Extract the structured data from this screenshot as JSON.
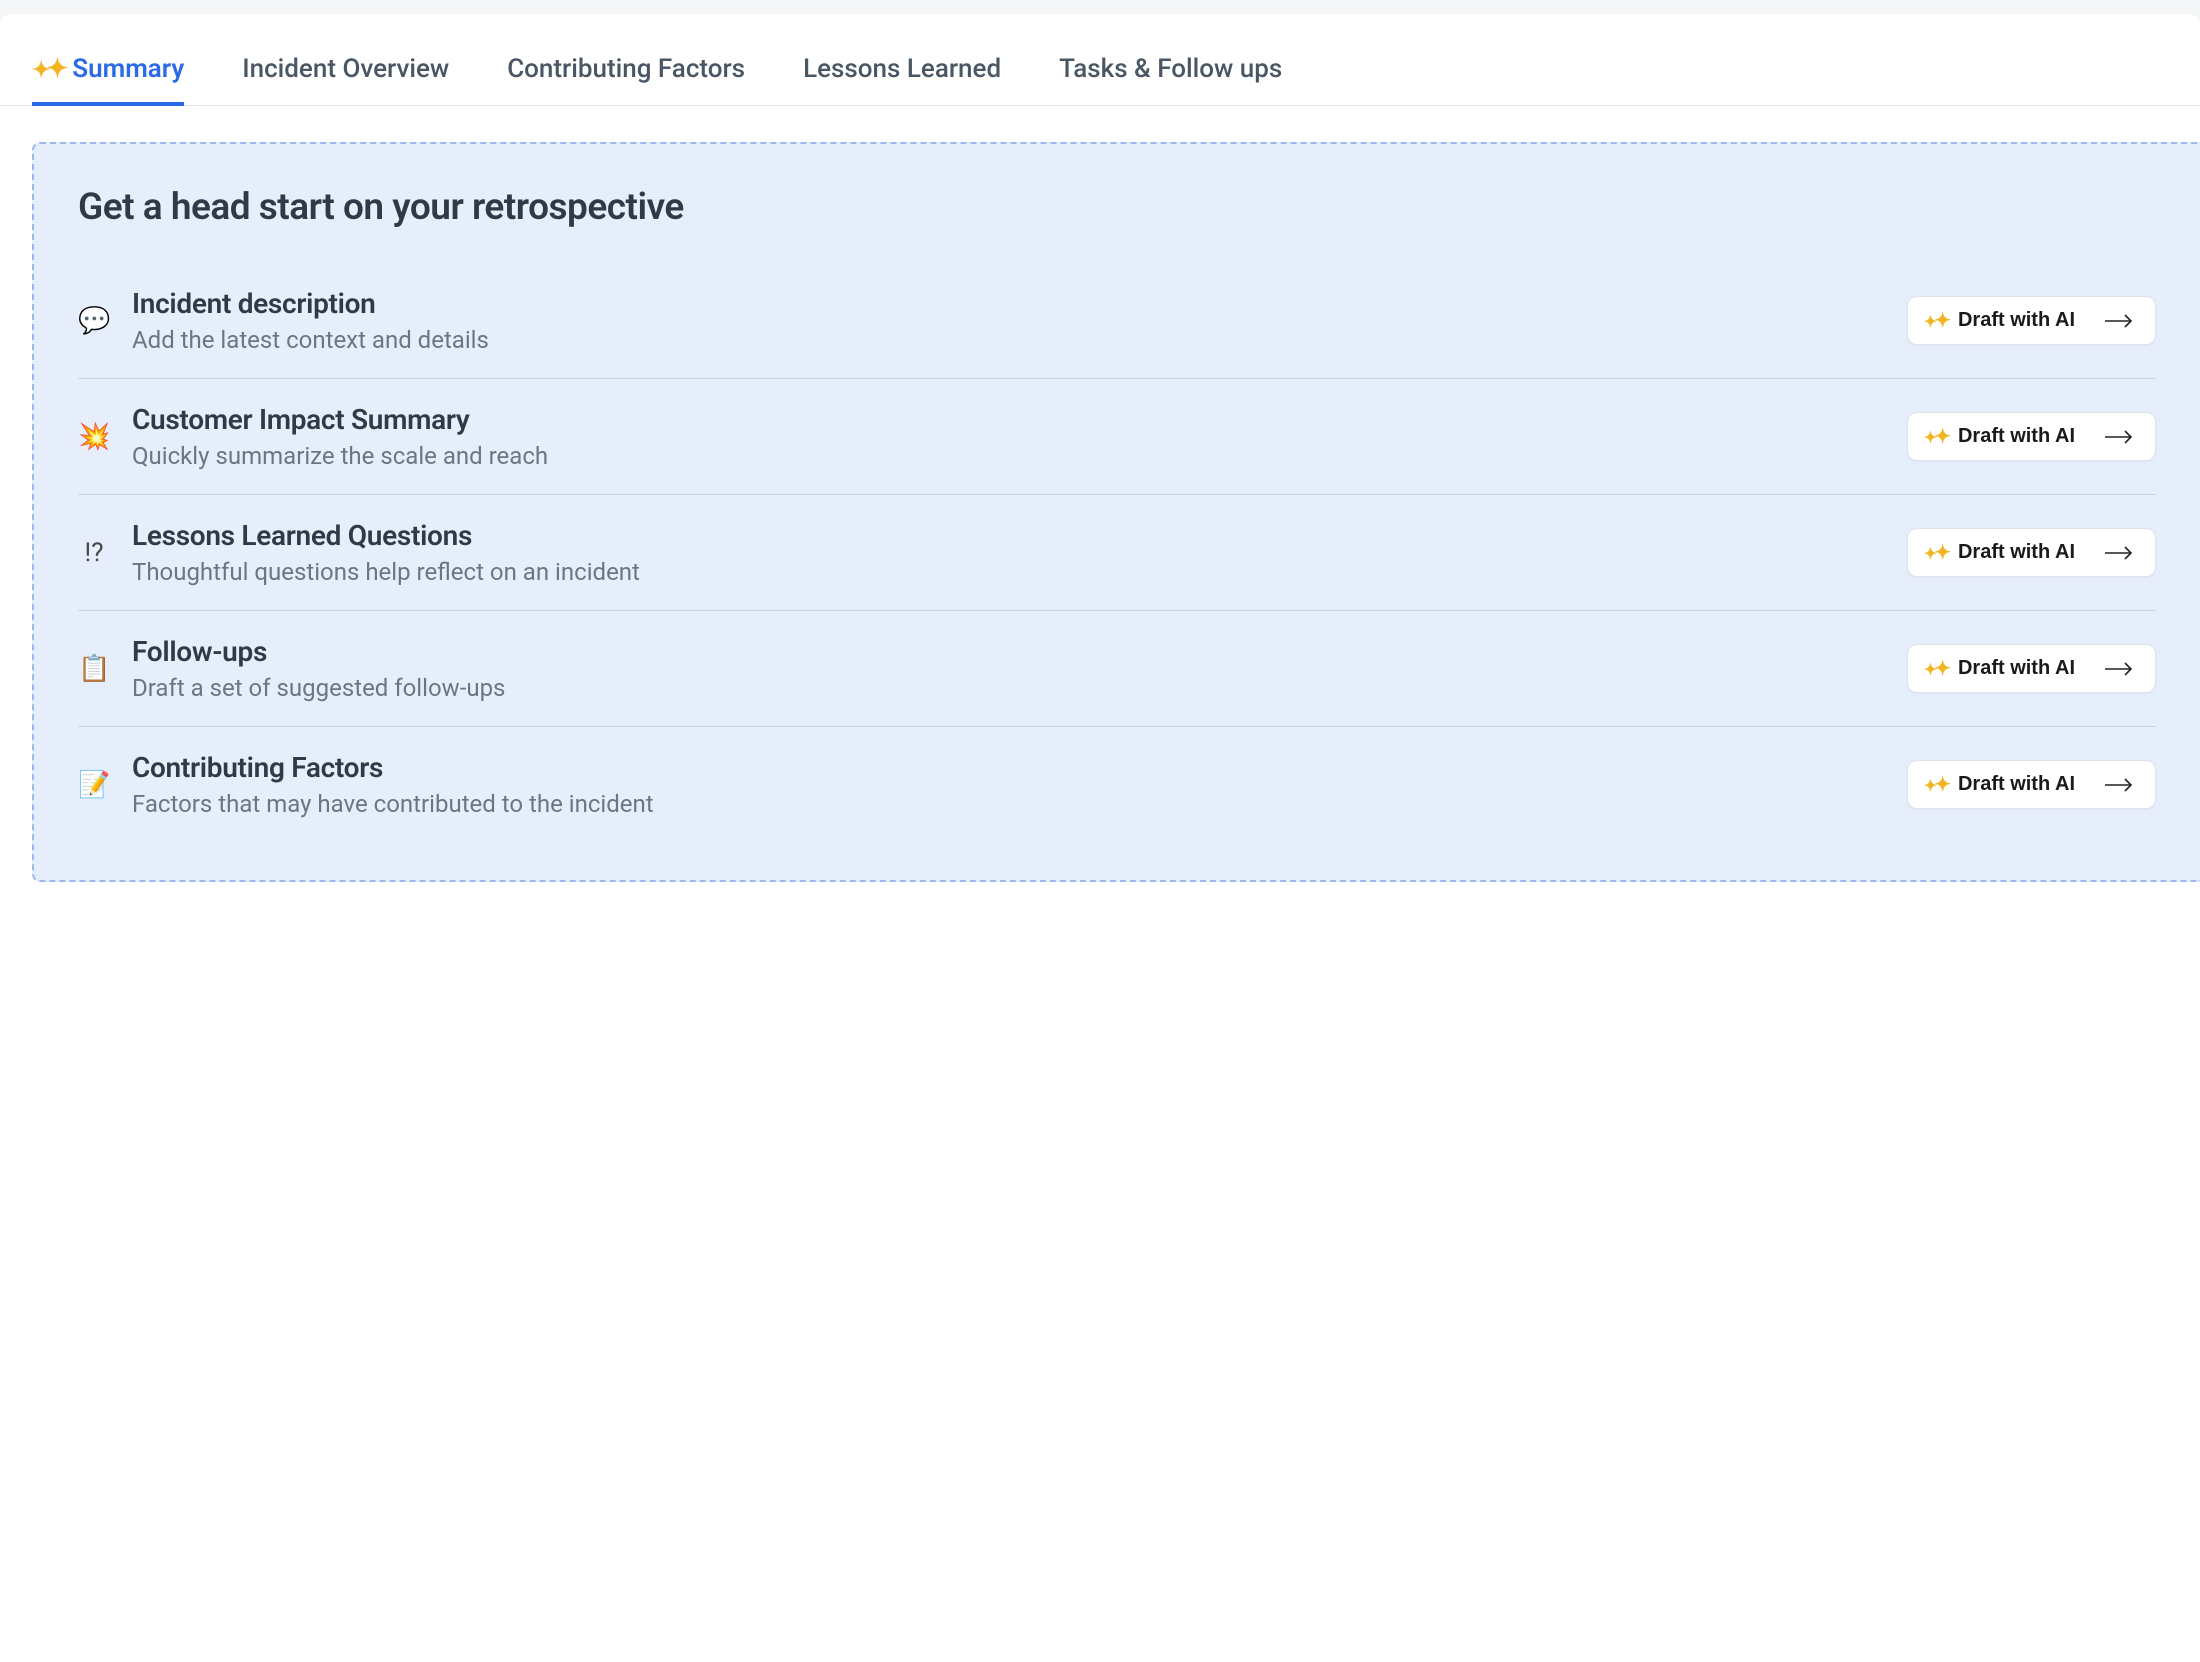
{
  "tabs": [
    {
      "label": "Summary",
      "active": true,
      "sparkle": true
    },
    {
      "label": "Incident Overview"
    },
    {
      "label": "Contributing Factors"
    },
    {
      "label": "Lessons Learned"
    },
    {
      "label": "Tasks & Follow ups"
    }
  ],
  "panel": {
    "title": "Get a head start on your retrospective",
    "draft_button_label": "Draft with AI",
    "rows": [
      {
        "icon": "💬",
        "title": "Incident description",
        "subtitle": "Add the latest context and details"
      },
      {
        "icon": "💥",
        "title": "Customer Impact Summary",
        "subtitle": "Quickly summarize the scale and reach"
      },
      {
        "icon": "!?",
        "title": "Lessons Learned Questions",
        "subtitle": "Thoughtful questions help reflect on an incident"
      },
      {
        "icon": "📋",
        "title": "Follow-ups",
        "subtitle": "Draft a set of suggested follow-ups"
      },
      {
        "icon": "📝",
        "title": "Contributing Factors",
        "subtitle": "Factors that may have contributed to the incident"
      }
    ]
  }
}
